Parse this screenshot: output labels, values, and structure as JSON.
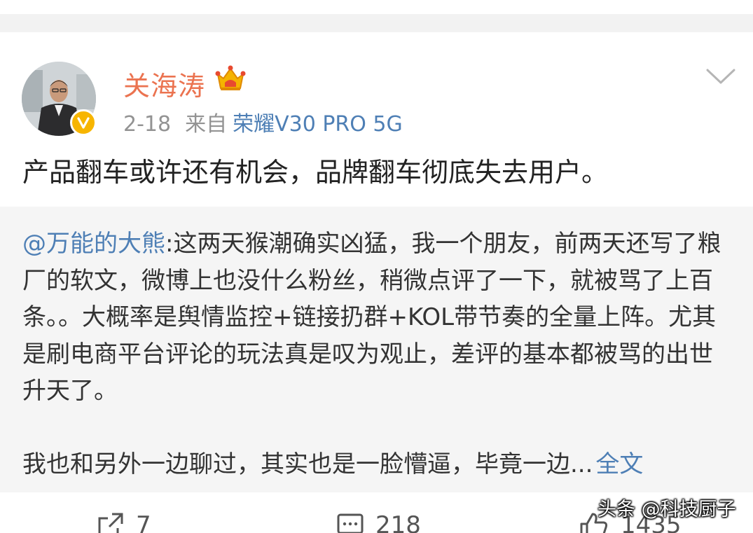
{
  "post": {
    "author": "关海涛",
    "date": "2-18",
    "source_prefix": "来自",
    "device": "荣耀V30 PRO 5G",
    "text": "产品翻车或许还有机会，品牌翻车彻底失去用户。"
  },
  "repost": {
    "mention": "@万能的大熊",
    "text": ":这两天猴潮确实凶猛，我一个朋友，前两天还写了粮厂的软文，微博上也没什么粉丝，稍微点评了一下，就被骂了上百条。。大概率是舆情监控+链接扔群+KOL带节奏的全量上阵。尤其是刷电商平台评论的玩法真是叹为观止，差评的基本都被骂的出世升天了。",
    "text2": "我也和另外一边聊过，其实也是一脸懵逼，毕竟一边...",
    "full_link": "全文"
  },
  "actions": {
    "share_count": "7",
    "comment_count": "218",
    "like_count": "1435"
  },
  "watermark": "头条 @科技厨子",
  "icons": {
    "verified": "verified-badge-icon",
    "crown": "crown-icon",
    "more": "chevron-down-icon",
    "share": "share-icon",
    "comment": "comment-icon",
    "like": "thumbs-up-icon"
  },
  "colors": {
    "author_name": "#eb7350",
    "link": "#4e7fb5",
    "verified": "#f7b500",
    "repost_bg": "#f5f5f5"
  }
}
